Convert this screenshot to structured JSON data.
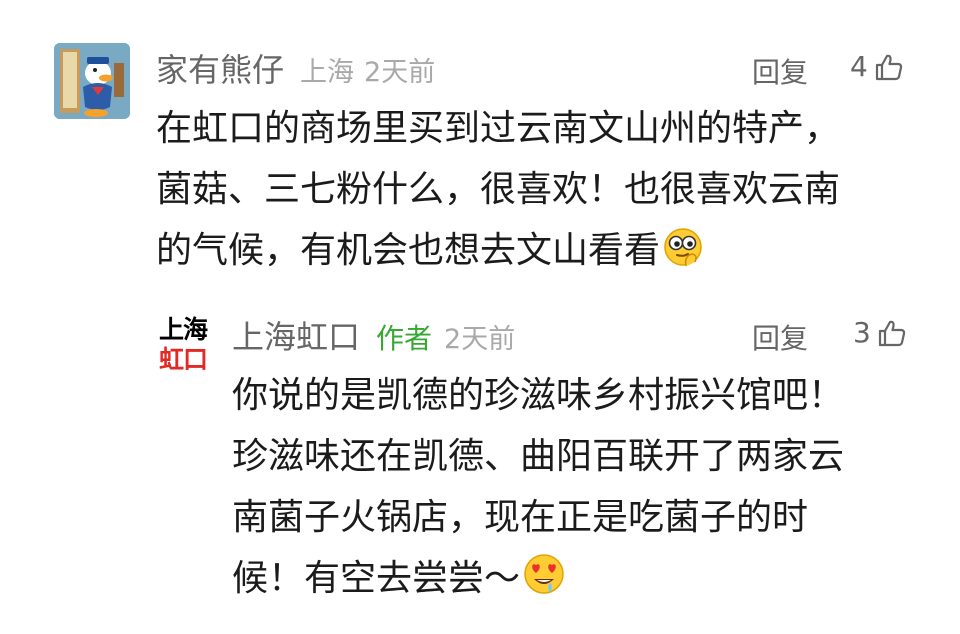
{
  "comments": [
    {
      "user": "家有熊仔",
      "location": "上海",
      "time": "2天前",
      "reply_label": "回复",
      "likes": "4",
      "lines": [
        "在虹口的商场里买到过云南文山州的特产，",
        "菌菇、三七粉什么，很喜欢！也很喜欢云南",
        "的气候，有机会也想去文山看看"
      ],
      "emoji": "thinking-eyes-emoji"
    }
  ],
  "reply": {
    "avatar_text_top": "上海",
    "avatar_text_bottom": "虹口",
    "user": "上海虹口",
    "badge": "作者",
    "time": "2天前",
    "reply_label": "回复",
    "likes": "3",
    "lines": [
      "你说的是凯德的珍滋味乡村振兴馆吧！",
      "珍滋味还在凯德、曲阳百联开了两家云",
      "南菌子火锅店，现在正是吃菌子的时",
      "候！有空去尝尝～"
    ],
    "emoji": "heart-eyes-drool-emoji"
  },
  "colors": {
    "username": "#666666",
    "meta": "#a9a9a9",
    "author_badge": "#37a832",
    "brand_red": "#e12a26",
    "body_text": "#1b1b1b"
  }
}
